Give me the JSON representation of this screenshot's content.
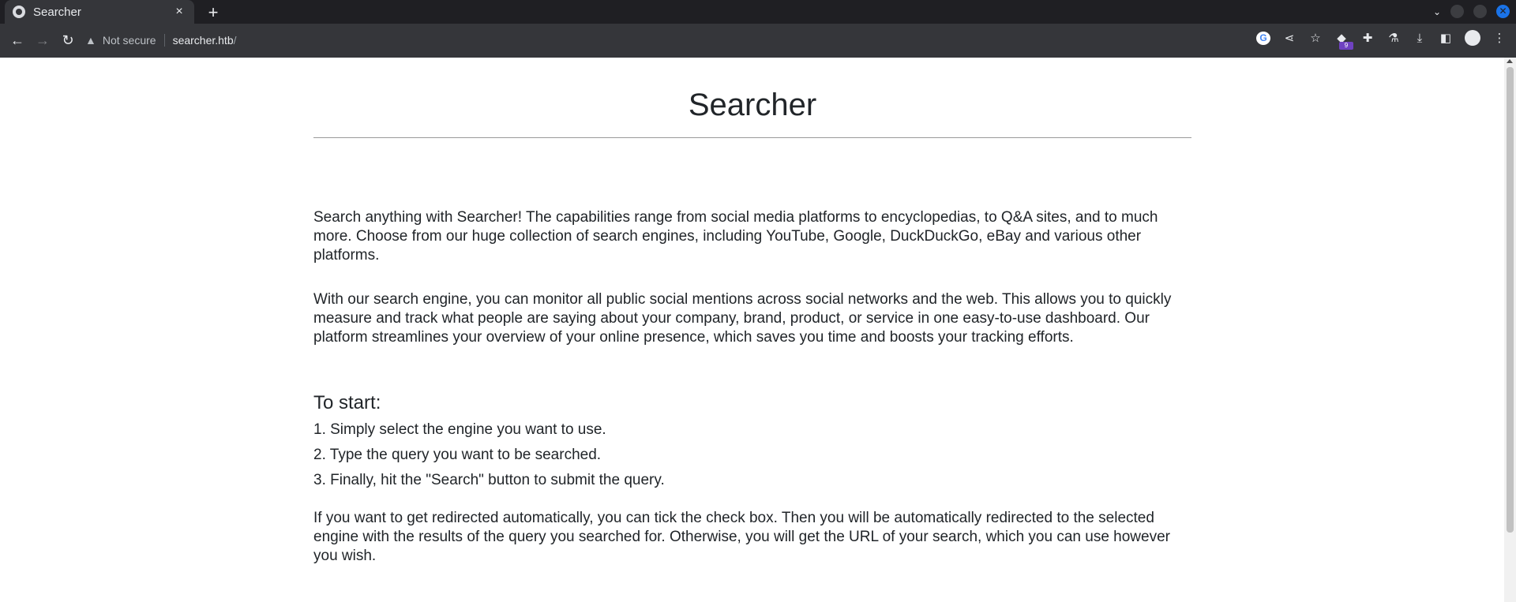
{
  "browser": {
    "tab_title": "Searcher",
    "tab_close": "×",
    "new_tab": "+",
    "security_label": "Not secure",
    "url_host": "searcher.htb",
    "url_path": "/",
    "extension_badge": "9",
    "icons": [
      "back-icon",
      "forward-icon",
      "reload-icon",
      "warning-icon",
      "google-icon",
      "share-icon",
      "star-icon",
      "extension-icon",
      "puzzle-icon",
      "labs-icon",
      "download-icon",
      "sidepanel-icon",
      "profile-icon",
      "menu-icon"
    ]
  },
  "page": {
    "title": "Searcher",
    "intro": "Search anything with Searcher! The capabilities range from social media platforms to encyclopedias, to Q&A sites, and to much more. Choose from our huge collection of search engines, including YouTube, Google, DuckDuckGo, eBay and various other platforms.",
    "monitor": "With our search engine, you can monitor all public social mentions across social networks and the web. This allows you to quickly measure and track what people are saying about your company, brand, product, or service in one easy-to-use dashboard. Our platform streamlines your overview of your online presence, which saves you time and boosts your tracking efforts.",
    "start_heading": "To start:",
    "steps": [
      "1. Simply select the engine you want to use.",
      "2. Type the query you want to be searched.",
      "3. Finally, hit the \"Search\" button to submit the query."
    ],
    "redirect": "If you want to get redirected automatically, you can tick the check box. Then you will be automatically redirected to the selected engine with the results of the query you searched for. Otherwise, you will get the URL of your search, which you can use however you wish."
  }
}
